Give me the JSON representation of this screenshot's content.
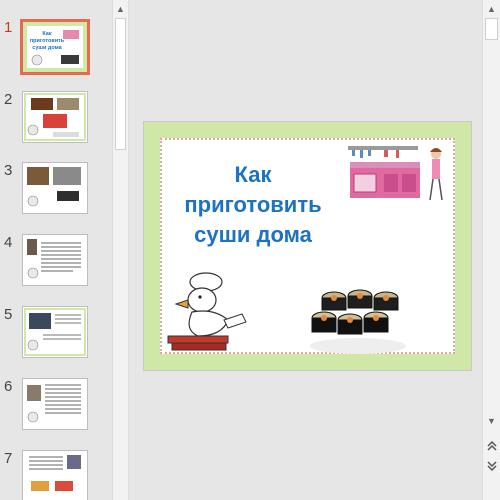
{
  "thumbnails": [
    {
      "number": "1",
      "caption": "Как приготовить суши дома",
      "active": true
    },
    {
      "number": "2",
      "caption": "",
      "active": false
    },
    {
      "number": "3",
      "caption": "",
      "active": false
    },
    {
      "number": "4",
      "caption": "",
      "active": false
    },
    {
      "number": "5",
      "caption": "",
      "active": false
    },
    {
      "number": "6",
      "caption": "",
      "active": false
    },
    {
      "number": "7",
      "caption": "",
      "active": false
    }
  ],
  "slide": {
    "title_line1": "Как",
    "title_line2": "приготовить",
    "title_line3": "суши дома"
  },
  "scrollbars": {
    "up_icon": "arrow-up-icon",
    "down_icon": "arrow-down-icon",
    "prev_slide_icon": "double-chevron-up-icon",
    "next_slide_icon": "double-chevron-down-icon"
  },
  "colors": {
    "active_thumb_border": "#e56a4f",
    "active_number": "#c43e1c",
    "title_blue": "#1c72c4",
    "frame_green": "#cfe8a8"
  }
}
